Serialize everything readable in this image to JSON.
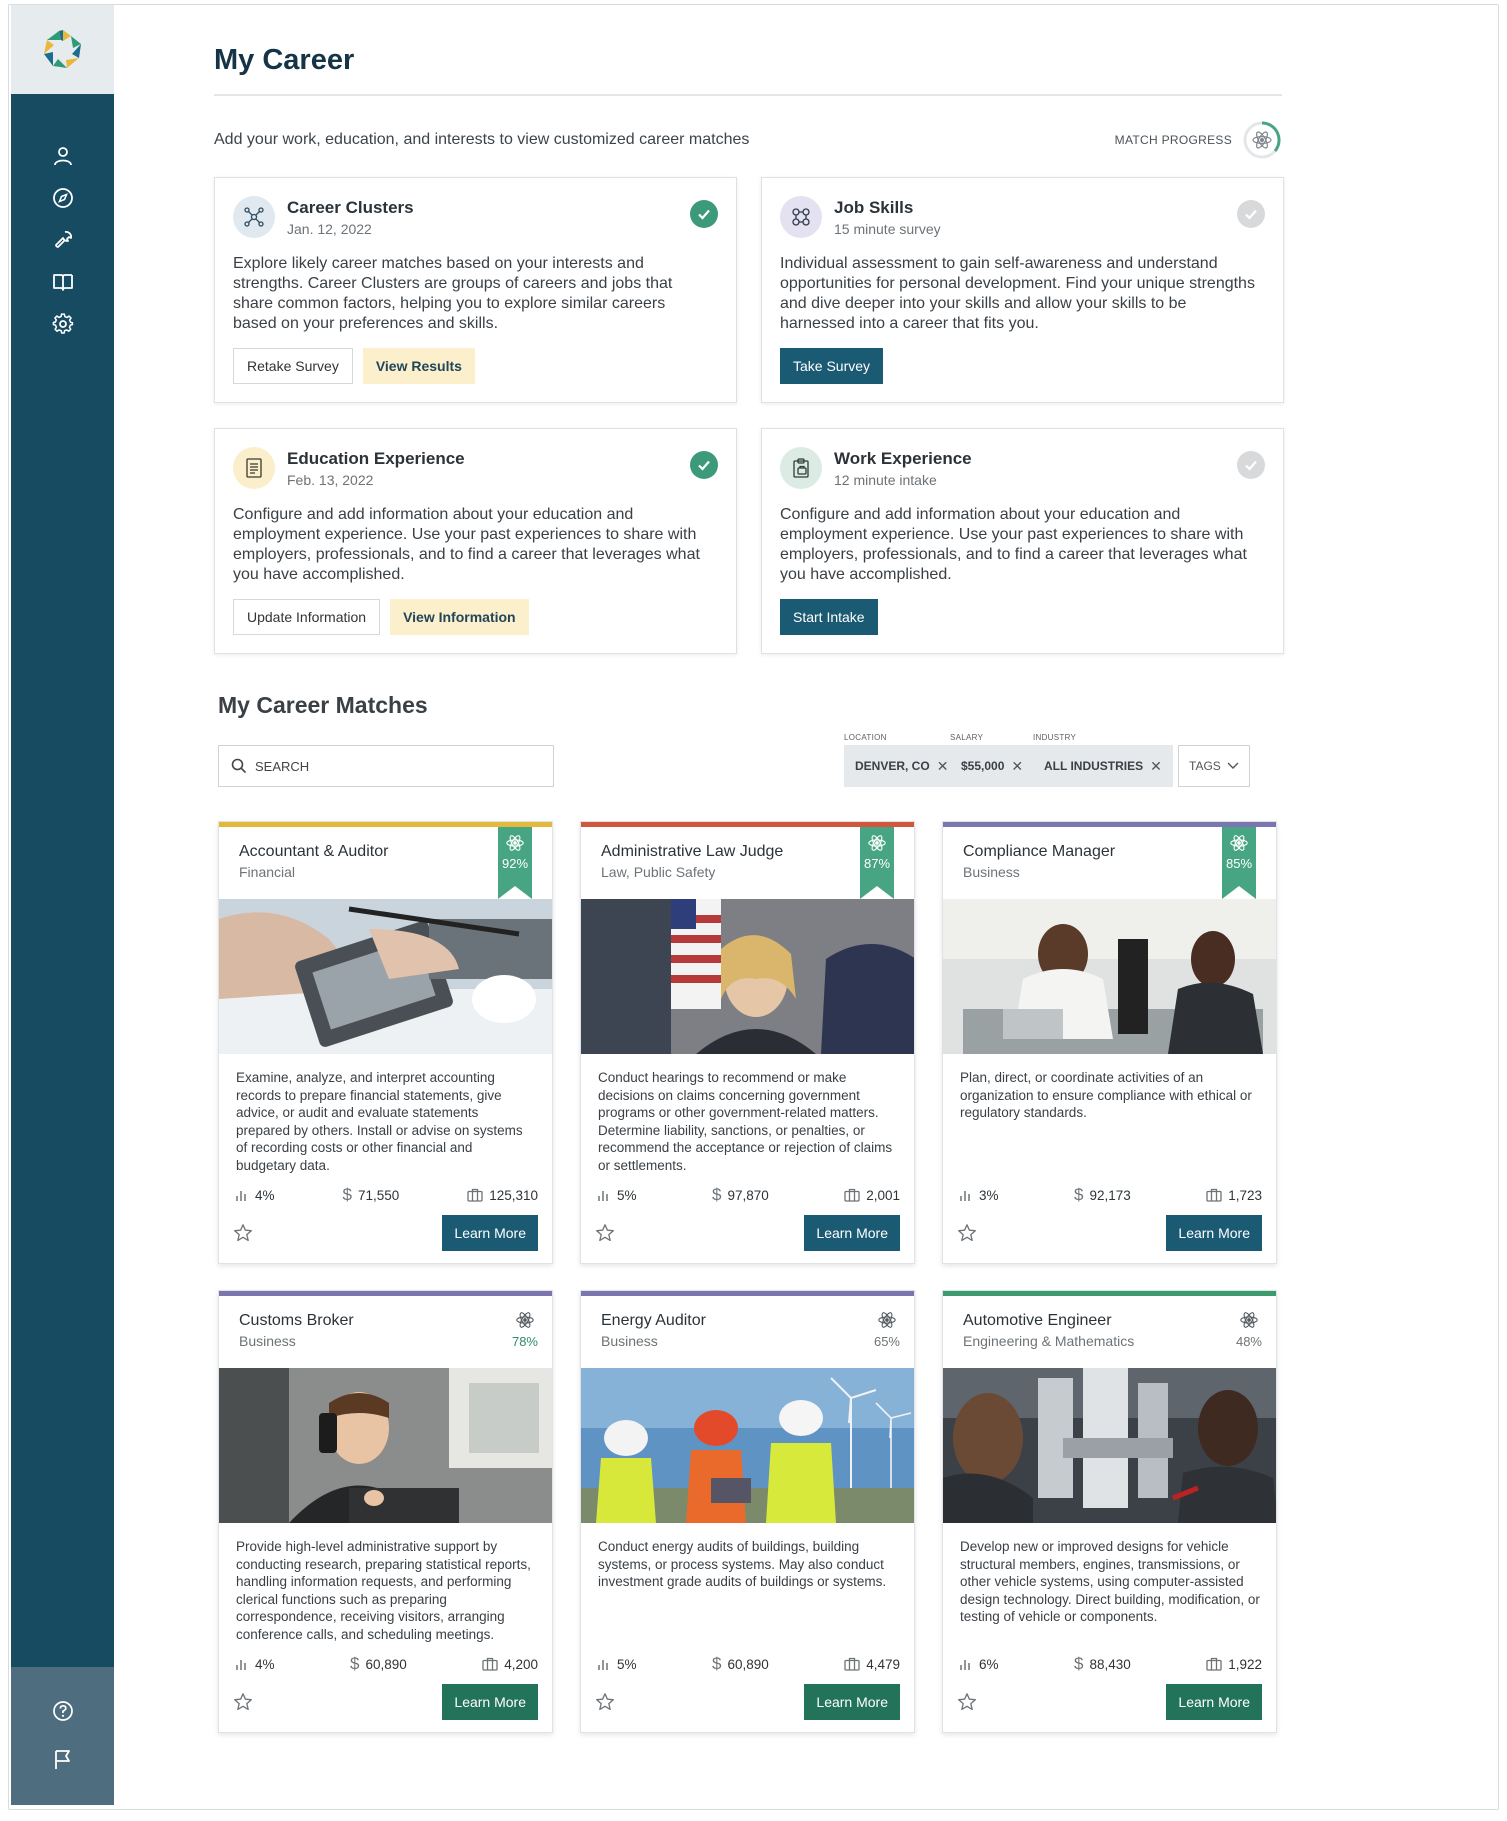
{
  "page": {
    "title": "My Career",
    "intro": "Add your work, education, and interests to view customized career matches",
    "match_progress_label": "MATCH PROGRESS"
  },
  "sidebar": {
    "items": [
      {
        "icon": "user-icon"
      },
      {
        "icon": "compass-icon"
      },
      {
        "icon": "wrench-icon"
      },
      {
        "icon": "book-icon"
      },
      {
        "icon": "gear-icon"
      }
    ],
    "bottom": [
      {
        "icon": "help-icon"
      },
      {
        "icon": "flag-icon"
      }
    ]
  },
  "steps": [
    {
      "title": "Career Clusters",
      "sub": "Jan. 12, 2022",
      "desc": "Explore likely career matches based on your interests and strengths. Career Clusters are groups of careers and jobs that share common factors, helping you to explore similar careers based on your preferences and skills.",
      "secondary": "Retake Survey",
      "primary": "View Results",
      "done": true
    },
    {
      "title": "Job Skills",
      "sub": "15 minute survey",
      "desc": "Individual assessment to gain self-awareness and understand opportunities for personal development. Find your unique strengths and dive deeper into your skills and allow your skills to be harnessed into a career that fits you.",
      "primary": "Take Survey",
      "done": false
    },
    {
      "title": "Education Experience",
      "sub": "Feb. 13, 2022",
      "desc": "Configure and add information about your education and employment experience. Use your past experiences to share with employers, professionals, and to find a career that leverages what you have accomplished.",
      "secondary": "Update Information",
      "primary": "View Information",
      "done": true
    },
    {
      "title": "Work Experience",
      "sub": "12 minute intake",
      "desc": "Configure and add information about your education and employment experience. Use your past experiences to share with employers, professionals, and to find a career that leverages what you have accomplished.",
      "primary": "Start Intake",
      "done": false
    }
  ],
  "matches": {
    "title": "My Career Matches",
    "search_placeholder": "SEARCH",
    "filters": {
      "location_label": "LOCATION",
      "location_value": "DENVER, CO",
      "salary_label": "SALARY",
      "salary_value": "$55,000",
      "industry_label": "INDUSTRY",
      "industry_value": "ALL INDUSTRIES",
      "tags_label": "TAGS"
    },
    "learn_more": "Learn More",
    "cards": [
      {
        "title": "Accountant & Auditor",
        "category": "Financial",
        "match": "92%",
        "bar_color": "#e2b93b",
        "desc": "Examine, analyze, and interpret accounting records to prepare financial statements, give advice, or audit and evaluate statements prepared by others. Install or advise on systems of recording costs or other financial and budgetary data.",
        "growth": "4%",
        "salary": "71,550",
        "jobs": "125,310"
      },
      {
        "title": "Administrative Law Judge",
        "category": "Law, Public Safety",
        "match": "87%",
        "bar_color": "#d0573b",
        "desc": "Conduct hearings to recommend or make decisions on claims concerning government programs or other government-related matters. Determine liability, sanctions, or penalties, or recommend the acceptance or rejection of claims or settlements.",
        "growth": "5%",
        "salary": "97,870",
        "jobs": "2,001"
      },
      {
        "title": "Compliance Manager",
        "category": "Business",
        "match": "85%",
        "bar_color": "#7b76b0",
        "desc": "Plan, direct, or coordinate activities of an organization to ensure compliance with ethical or regulatory standards.",
        "growth": "3%",
        "salary": "92,173",
        "jobs": "1,723"
      },
      {
        "title": "Customs Broker",
        "category": "Business",
        "match": "78%",
        "bar_color": "#7b76b0",
        "desc": "Provide high-level administrative support by conducting research, preparing statistical reports, handling information requests, and performing clerical functions such as preparing correspondence, receiving visitors, arranging conference calls, and scheduling meetings.",
        "growth": "4%",
        "salary": "60,890",
        "jobs": "4,200"
      },
      {
        "title": "Energy Auditor",
        "category": "Business",
        "match": "65%",
        "bar_color": "#7b76b0",
        "desc": "Conduct energy audits of buildings, building systems, or process systems. May also conduct investment grade audits of buildings or systems.",
        "growth": "5%",
        "salary": "60,890",
        "jobs": "4,479"
      },
      {
        "title": "Automotive Engineer",
        "category": "Engineering & Mathematics",
        "match": "48%",
        "bar_color": "#3c9a6c",
        "desc": "Develop new or improved designs for vehicle structural members, engines, transmissions, or other vehicle systems, using computer-assisted design technology. Direct building, modification, or testing of vehicle or components.",
        "growth": "6%",
        "salary": "88,430",
        "jobs": "1,922"
      }
    ]
  }
}
